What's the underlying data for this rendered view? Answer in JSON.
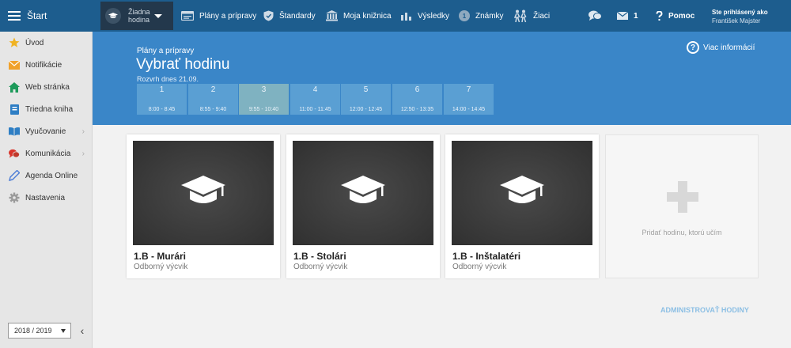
{
  "topbar": {
    "start_label": "Štart",
    "lesson_line1": "Žiadna",
    "lesson_line2": "hodina",
    "nav": [
      {
        "label": "Plány a prípravy",
        "icon": "calendar-icon"
      },
      {
        "label": "Štandardy",
        "icon": "shield-icon"
      },
      {
        "label": "Moja knižnica",
        "icon": "library-icon"
      },
      {
        "label": "Výsledky",
        "icon": "bar-chart-icon"
      },
      {
        "label": "Známky",
        "icon": "grade-badge-icon"
      },
      {
        "label": "Žiaci",
        "icon": "students-icon"
      }
    ],
    "chat_icon": "chat-icon",
    "messages_count": "1",
    "help_label": "Pomoc",
    "user_line1": "Ste prihlásený ako",
    "user_name": "František Majster",
    "bg_color": "#1d5d8e",
    "accent_dark": "#23384c"
  },
  "sidebar": {
    "items": [
      {
        "label": "Úvod",
        "icon": "star-icon"
      },
      {
        "label": "Notifikácie",
        "icon": "envelope-icon"
      },
      {
        "label": "Web stránka",
        "icon": "home-icon"
      },
      {
        "label": "Triedna kniha",
        "icon": "class-book-icon"
      },
      {
        "label": "Vyučovanie",
        "icon": "open-book-icon",
        "has_submenu": true
      },
      {
        "label": "Komunikácia",
        "icon": "speech-bubbles-icon",
        "has_submenu": true
      },
      {
        "label": "Agenda Online",
        "icon": "pen-icon"
      },
      {
        "label": "Nastavenia",
        "icon": "gear-icon"
      }
    ],
    "school_year": "2018 / 2019"
  },
  "header": {
    "breadcrumb": "Plány a prípravy",
    "title": "Vybrať hodinu",
    "schedule_label": "Rozvrh dnes 21.09.",
    "more_info": "Viac informácií",
    "bg_color": "#3a86c8",
    "periods": [
      {
        "num": "1",
        "time": "8:00 - 8:45",
        "active": false
      },
      {
        "num": "2",
        "time": "8:55 - 9:40",
        "active": false
      },
      {
        "num": "3",
        "time": "9:55 - 10:40",
        "active": true
      },
      {
        "num": "4",
        "time": "11:00 - 11:45",
        "active": false
      },
      {
        "num": "5",
        "time": "12:00 - 12:45",
        "active": false
      },
      {
        "num": "6",
        "time": "12:50 - 13:35",
        "active": false
      },
      {
        "num": "7",
        "time": "14:00 - 14:45",
        "active": false
      }
    ]
  },
  "content": {
    "cards": [
      {
        "title": "1.B - Murári",
        "subtitle": "Odborný výcvik",
        "icon": "graduation-cap-icon"
      },
      {
        "title": "1.B - Stolári",
        "subtitle": "Odborný výcvik",
        "icon": "graduation-cap-icon"
      },
      {
        "title": "1.B - Inštalatéri",
        "subtitle": "Odborný výcvik",
        "icon": "graduation-cap-icon"
      }
    ],
    "add_card_label": "Pridať hodinu, ktorú učím",
    "admin_link": "ADMINISTROVAŤ HODINY"
  }
}
